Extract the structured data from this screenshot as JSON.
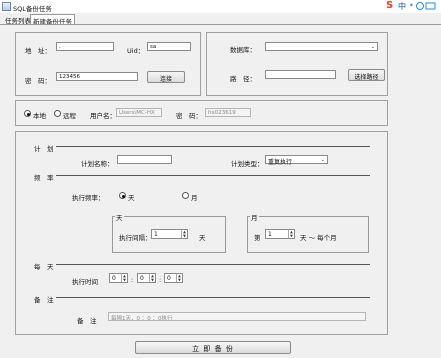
{
  "window": {
    "title": "SQL备份任务"
  },
  "tabs": [
    {
      "label": "任务列表"
    },
    {
      "label": "新建备份任务"
    }
  ],
  "system_icons": {
    "s_glyph": "S",
    "zhong_glyph": "中",
    "dots_glyph": "•"
  },
  "connection": {
    "address_label": "地　址：",
    "address_value": ".",
    "uid_label": "Uid：",
    "uid_value": "sa",
    "password_label": "密　码：",
    "password_value": "123456",
    "connect_button": "连接"
  },
  "database": {
    "db_label": "数据库：",
    "db_value": "",
    "path_label": "路　径：",
    "path_value": "",
    "choose_path_button": "选择路径"
  },
  "location": {
    "local_label": "本地",
    "local_selected": true,
    "remote_label": "远程",
    "remote_selected": false,
    "username_label": "用户名：",
    "username_placeholder": "Users\\MC-HX",
    "password_label": "密　码：",
    "password_placeholder": "hx023619"
  },
  "plan": {
    "section_title": "计　划",
    "name_label": "计划名称：",
    "name_value": "",
    "type_label": "计划类型：",
    "type_value": "重复执行"
  },
  "frequency": {
    "section_title": "频　率",
    "freq_label": "执行频率：",
    "day_label": "天",
    "day_selected": true,
    "month_label": "月",
    "month_selected": false,
    "day_group_title": "天",
    "interval_label": "执行间隔：",
    "interval_value": "1",
    "interval_unit": "天",
    "month_group_title": "月",
    "month_prefix": "第",
    "month_day_value": "1",
    "month_suffix": "天 ～ 每个月"
  },
  "daily": {
    "section_title": "每　天",
    "time_label": "执行时间",
    "hour": "0",
    "minute": "0",
    "second": "0",
    "sep": ":"
  },
  "remark": {
    "section_title": "备　注",
    "label": "备　注",
    "value": "每隔1天，0 ：0 ：0执行"
  },
  "actions": {
    "backup_now": "立 即 备 份"
  },
  "spin_arrows": {
    "up": "▲",
    "down": "▼"
  },
  "caret": "⌄"
}
